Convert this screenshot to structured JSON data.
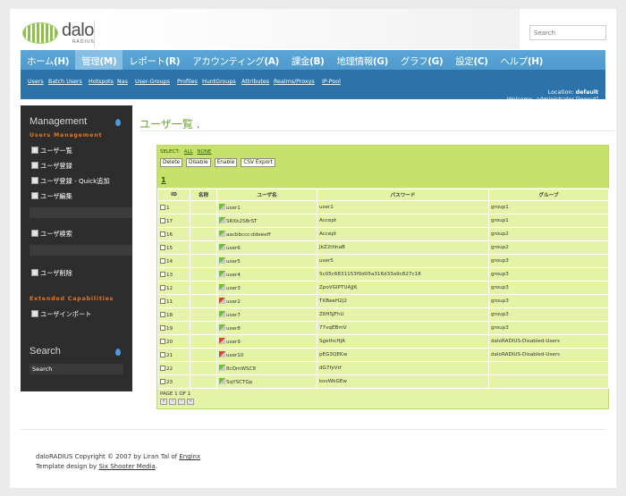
{
  "search_top": {
    "placeholder": "Search"
  },
  "logo": {
    "text": "dalo",
    "sub": "RADIUS"
  },
  "main_menu": [
    {
      "label": "ホーム",
      "key": "(H)",
      "active": false
    },
    {
      "label": "管理",
      "key": "(M)",
      "active": true
    },
    {
      "label": "レポート",
      "key": "(R)",
      "active": false
    },
    {
      "label": "アカウンティング",
      "key": "(A)",
      "active": false
    },
    {
      "label": "課金",
      "key": "(B)",
      "active": false
    },
    {
      "label": "地理情報",
      "key": "(G)",
      "active": false
    },
    {
      "label": "グラフ",
      "key": "(G)",
      "active": false
    },
    {
      "label": "設定",
      "key": "(C)",
      "active": false
    },
    {
      "label": "ヘルプ",
      "key": "(H)",
      "active": false
    }
  ],
  "sub_menu": [
    "Users",
    "Batch Users",
    "Hotspots",
    "Nas",
    "User-Groups",
    "Profiles",
    "HuntGroups",
    "Attributes",
    "Realms/Proxys",
    "IP-Pool"
  ],
  "location": {
    "label": "Location:",
    "value": "default",
    "welcome": "Welcome, administrator",
    "logout": "[logout]"
  },
  "sidebar": {
    "title": "Management",
    "category1": "Users Management",
    "items": [
      "ユーザ一覧",
      "ユーザ登録",
      "ユーザ登録 - Quick追加",
      "ユーザ編集",
      "ユーザ検索",
      "ユーザ削除"
    ],
    "category2": "Extended Capabilities",
    "items2": [
      "ユーザインポート"
    ],
    "search_title": "Search",
    "search_value": "Search"
  },
  "content": {
    "title": "ユーザ一覧"
  },
  "panel": {
    "select_label": "SELECT:",
    "select_all": "ALL",
    "select_none": "NONE",
    "buttons": [
      "Delete",
      "Disable",
      "Enable",
      "CSV Export"
    ],
    "page_link": "1",
    "columns": [
      "ID",
      "名称",
      "ユーザ名",
      "パスワード",
      "グループ"
    ],
    "rows": [
      {
        "id": "1",
        "name": "",
        "user": "user1",
        "password": "user1",
        "group": "group1",
        "status": "ok"
      },
      {
        "id": "17",
        "name": "",
        "user": "SRXk2S8rST",
        "password": "Accept",
        "group": "group1",
        "status": "ok"
      },
      {
        "id": "16",
        "name": "",
        "user": "aacbbccc:ddeeeff",
        "password": "Accept",
        "group": "group2",
        "status": "ok"
      },
      {
        "id": "15",
        "name": "",
        "user": "user6",
        "password": "JkZ2thhaB",
        "group": "group2",
        "status": "ok"
      },
      {
        "id": "14",
        "name": "",
        "user": "user5",
        "password": "user5",
        "group": "group3",
        "status": "ok"
      },
      {
        "id": "13",
        "name": "",
        "user": "user4",
        "password": "5c05c6831153f0d05a316d33a9c827c18",
        "group": "group3",
        "status": "ok"
      },
      {
        "id": "12",
        "name": "",
        "user": "user3",
        "password": "ZpoVGIPTUAJJ6",
        "group": "group3",
        "status": "ok"
      },
      {
        "id": "11",
        "name": "",
        "user": "user2",
        "password": "TXBeeH2J2",
        "group": "group3",
        "status": "bad"
      },
      {
        "id": "18",
        "name": "",
        "user": "user7",
        "password": "Z6HSJFhU",
        "group": "group3",
        "status": "ok"
      },
      {
        "id": "19",
        "name": "",
        "user": "user8",
        "password": "77vqEBmV",
        "group": "group3",
        "status": "ok"
      },
      {
        "id": "20",
        "name": "",
        "user": "user9",
        "password": "SgethcHJA",
        "group": "daloRADIUS-Disabled-Users",
        "status": "bad"
      },
      {
        "id": "21",
        "name": "",
        "user": "user10",
        "password": "pEG3QEKw",
        "group": "daloRADIUS-Disabled-Users",
        "status": "bad"
      },
      {
        "id": "22",
        "name": "",
        "user": "8cQmWSC8",
        "password": "dG7fyVrf",
        "group": "",
        "status": "ok"
      },
      {
        "id": "23",
        "name": "",
        "user": "SqYSCTGp",
        "password": "kovWkGEw",
        "group": "",
        "status": "ok"
      }
    ],
    "page_info": "PAGE 1 OF 1"
  },
  "footer": {
    "line1_prefix": "daloRADIUS Copyright © 2007 by Liran Tal of",
    "line1_link": "Enginx",
    "line2_prefix": "Template design by",
    "line2_link": "Six Shooter Media",
    "line2_suffix": "."
  }
}
